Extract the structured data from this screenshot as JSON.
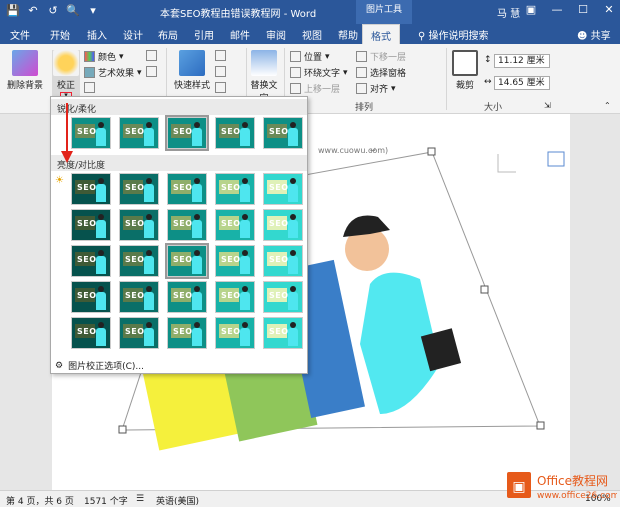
{
  "window": {
    "title": "本套SEO教程由错误教程网 - Word",
    "context_tool": "图片工具",
    "user": "马 慧",
    "share": "共享",
    "tell_me": "操作说明搜索"
  },
  "tabs": [
    "文件",
    "开始",
    "插入",
    "设计",
    "布局",
    "引用",
    "邮件",
    "审阅",
    "视图",
    "帮助",
    "格式"
  ],
  "active_tab": "格式",
  "ribbon": {
    "remove_bg": "删除背景",
    "correct": "校正",
    "color": "颜色",
    "artistic": "艺术效果",
    "quick_styles": "快速样式",
    "replace_text": "替换文字",
    "position": "位置",
    "wrap_text": "环绕文字",
    "bring_forward": "上移一层",
    "send_backward": "下移一层",
    "selection_pane": "选择窗格",
    "align": "对齐",
    "crop": "裁剪",
    "height": "11.12 厘米",
    "width": "14.65 厘米",
    "group_arrange": "排列",
    "group_size": "大小"
  },
  "gallery": {
    "section_sharpen": "锐化/柔化",
    "section_brightness": "亮度/对比度",
    "footer": "图片校正选项(C)..."
  },
  "document": {
    "caption": "www.cuowu.com)"
  },
  "statusbar": {
    "page": "第 4 页，共 6 页",
    "words": "1571 个字",
    "lang": "英语(美国)",
    "zoom": "100%"
  },
  "watermark": {
    "brand": "Office教程网",
    "url": "www.office26.com"
  },
  "colors": {
    "titlebar": "#2b579a",
    "teal": "#0d8f86",
    "cyan": "#4ee6ef"
  }
}
